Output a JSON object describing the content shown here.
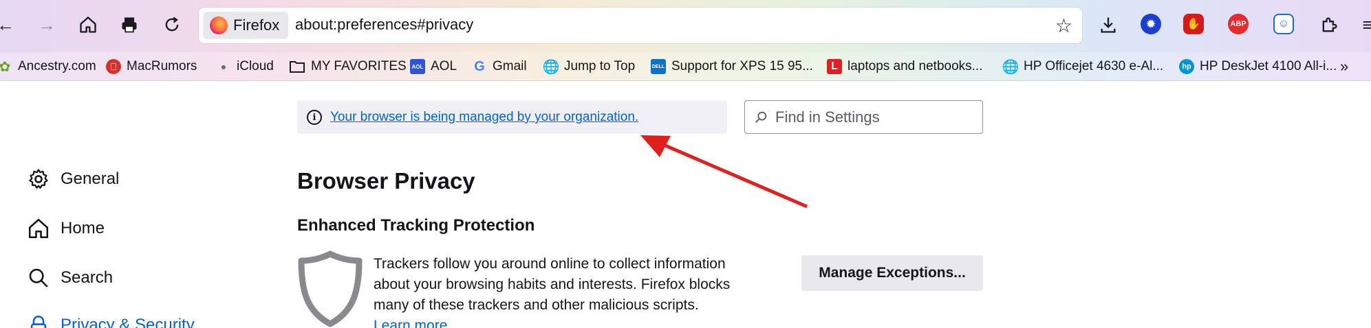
{
  "toolbar": {
    "identity_label": "Firefox",
    "url": "about:preferences#privacy"
  },
  "extensions": {
    "ublock_label": "",
    "abp_label": "ABP"
  },
  "bookmarks": [
    {
      "label": "Ancestry.com",
      "icon": "leaf-icon"
    },
    {
      "label": "MacRumors",
      "icon": "apple-red-icon"
    },
    {
      "label": "iCloud",
      "icon": "apple-icon"
    },
    {
      "label": "MY FAVORITES",
      "icon": "folder-icon"
    },
    {
      "label": "AOL",
      "icon": "aol-icon",
      "icon_text": "AOL"
    },
    {
      "label": "Gmail",
      "icon": "google-icon",
      "icon_text": "G"
    },
    {
      "label": "Jump to Top",
      "icon": "globe-icon"
    },
    {
      "label": "Support for XPS 15 95...",
      "icon": "dell-icon",
      "icon_text": "DELL"
    },
    {
      "label": "laptops and netbooks...",
      "icon": "l-icon",
      "icon_text": "L"
    },
    {
      "label": "HP Officejet 4630 e-Al...",
      "icon": "globe-icon"
    },
    {
      "label": "HP DeskJet 4100 All-i...",
      "icon": "hp-icon",
      "icon_text": "hp"
    }
  ],
  "notice": {
    "text": "Your browser is being managed by your organization."
  },
  "search": {
    "placeholder": "Find in Settings"
  },
  "sidebar": {
    "items": [
      {
        "label": "General",
        "icon": "gear-icon"
      },
      {
        "label": "Home",
        "icon": "home-icon"
      },
      {
        "label": "Search",
        "icon": "search-icon"
      },
      {
        "label": "Privacy & Security",
        "icon": "lock-icon"
      }
    ]
  },
  "main": {
    "title": "Browser Privacy",
    "section_title": "Enhanced Tracking Protection",
    "description": "Trackers follow you around online to collect information about your browsing habits and interests. Firefox blocks many of these trackers and other malicious scripts.",
    "learn_more": "Learn more",
    "manage_button": "Manage Exceptions..."
  },
  "colors": {
    "accent": "#0061e0",
    "arrow": "#e0201f"
  }
}
